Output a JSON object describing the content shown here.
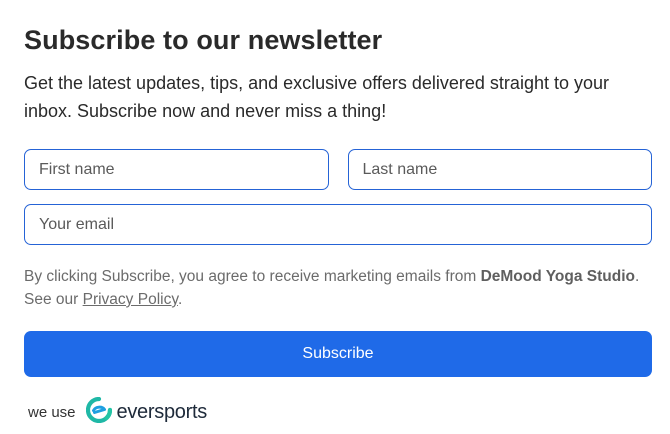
{
  "newsletter": {
    "title": "Subscribe to our newsletter",
    "description": "Get the latest updates, tips, and exclusive offers delivered straight to your inbox. Subscribe now and never miss a thing!",
    "first_name": {
      "placeholder": "First name",
      "value": ""
    },
    "last_name": {
      "placeholder": "Last name",
      "value": ""
    },
    "email": {
      "placeholder": "Your email",
      "value": ""
    },
    "consent": {
      "prefix": "By clicking Subscribe, you agree to receive marketing emails from ",
      "studio": "DeMood Yoga Studio",
      "middle": ". See our ",
      "privacy_link": "Privacy Policy",
      "suffix": "."
    },
    "subscribe_label": "Subscribe"
  },
  "footer": {
    "we_use": "we use",
    "brand": "eversports",
    "brand_icon": "eversports-logo-icon",
    "brand_color": "#1fb8a6"
  },
  "colors": {
    "accent": "#1f6ae8",
    "input_border": "#2563d6"
  }
}
